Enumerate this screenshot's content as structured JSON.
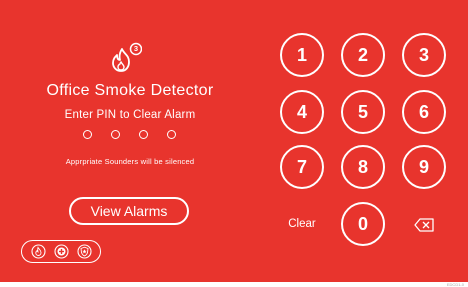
{
  "alarm": {
    "count_badge": "3",
    "title": "Office Smoke Detector",
    "prompt": "Enter PIN to Clear Alarm",
    "info": "Apprpriate Sounders will be silenced"
  },
  "pin": {
    "entered_digits": 0,
    "length": 4
  },
  "buttons": {
    "view_alarms": "View Alarms",
    "clear": "Clear"
  },
  "keypad": [
    "1",
    "2",
    "3",
    "4",
    "5",
    "6",
    "7",
    "8",
    "9",
    "0"
  ],
  "status_icons": [
    "fire-icon",
    "medical-icon",
    "security-icon"
  ],
  "footer": {
    "label": "EDCD1-0"
  },
  "colors": {
    "background": "#e8342d",
    "foreground": "#ffffff"
  }
}
